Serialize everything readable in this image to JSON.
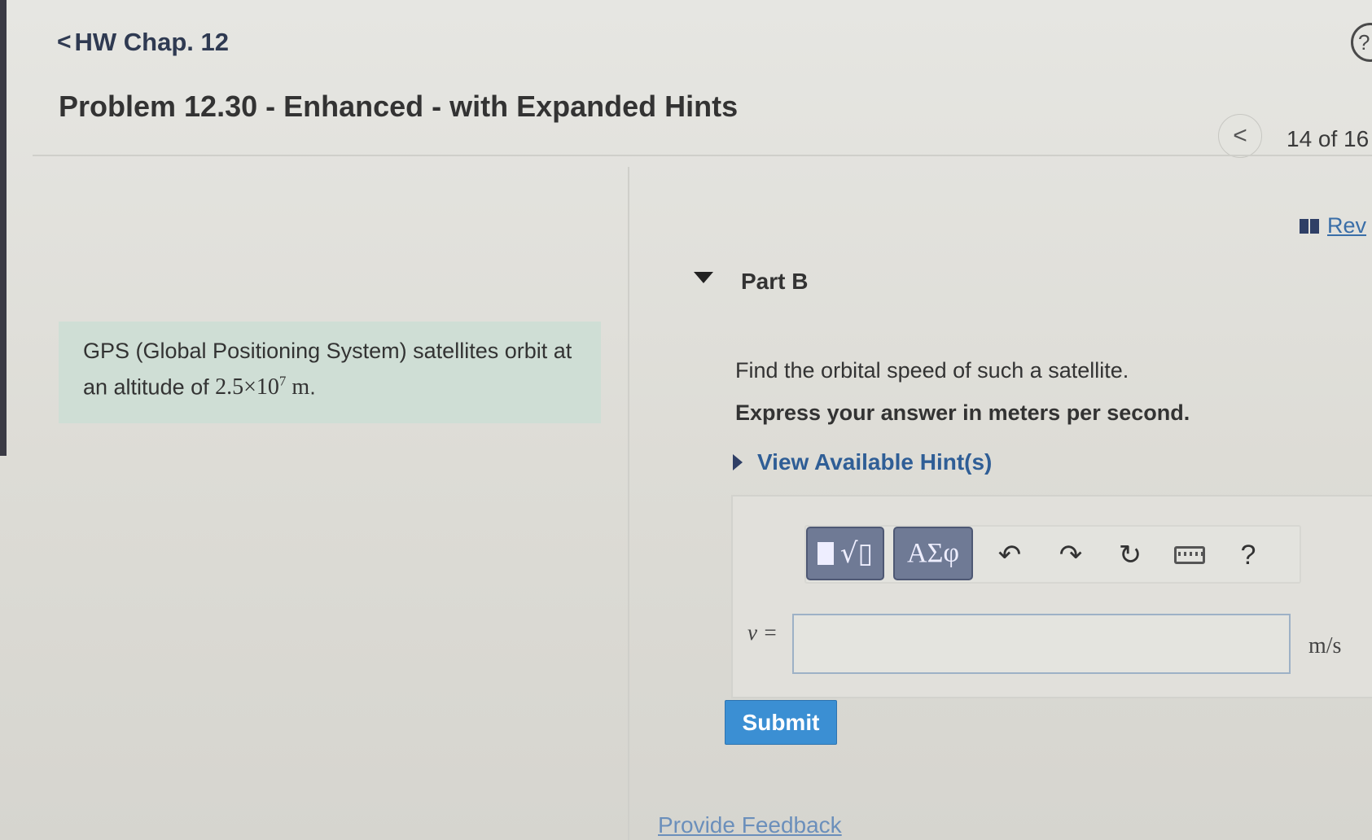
{
  "header": {
    "back_chevron": "<",
    "back_label": "HW Chap. 12",
    "problem_title": "Problem 12.30 - Enhanced - with Expanded Hints",
    "top_right_icon_glyph": "?",
    "nav_prev_glyph": "<",
    "nav_count": "14 of 16",
    "review_label": "Rev"
  },
  "problem_info": {
    "text_before": "GPS (Global Positioning System) satellites orbit at an altitude of ",
    "value_mantissa": "2.5×10",
    "value_exponent": "7",
    "value_unit": "m",
    "text_after": "."
  },
  "part": {
    "label": "Part B",
    "expanded": true,
    "question": "Find the orbital speed of such a satellite.",
    "instruction": "Express your answer in meters per second.",
    "hints_label": "View Available Hint(s)"
  },
  "toolbar": {
    "templates_icon": "templates-sqrt-icon",
    "symbols_label": "ΑΣφ",
    "undo_glyph": "↶",
    "redo_glyph": "↷",
    "reset_glyph": "↻",
    "help_label": "?"
  },
  "answer": {
    "variable_label": "v =",
    "value": "",
    "placeholder": "",
    "unit": "m/s"
  },
  "actions": {
    "submit_label": "Submit",
    "feedback_label": "Provide Feedback"
  },
  "colors": {
    "info_box_bg": "#cfded5",
    "submit_bg": "#3b8fd3",
    "toolbar_button_bg": "#6f7a95",
    "link_color": "#2f5e96"
  }
}
